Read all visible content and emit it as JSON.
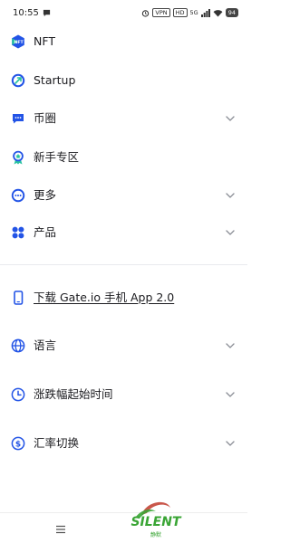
{
  "status_bar": {
    "time": "10:55",
    "vpn": "VPN",
    "hd": "HD",
    "network": "5G",
    "battery": "94"
  },
  "menu": {
    "nft": "NFT",
    "startup": "Startup",
    "coin_circle": "币圈",
    "newbie_zone": "新手专区",
    "more": "更多",
    "products": "产品",
    "download_app": "下载 Gate.io 手机 App 2.0",
    "language": "语言",
    "price_change_start_time": "涨跌幅起始时间",
    "exchange_rate_switch": "汇率切换"
  },
  "colors": {
    "accent": "#2354e6",
    "text": "#1b1b1f",
    "chevron": "#8a8d95",
    "watermark_green": "#3aa535",
    "watermark_red": "#c0392b"
  },
  "watermark": {
    "text": "SILENT",
    "subtext": "静默"
  }
}
